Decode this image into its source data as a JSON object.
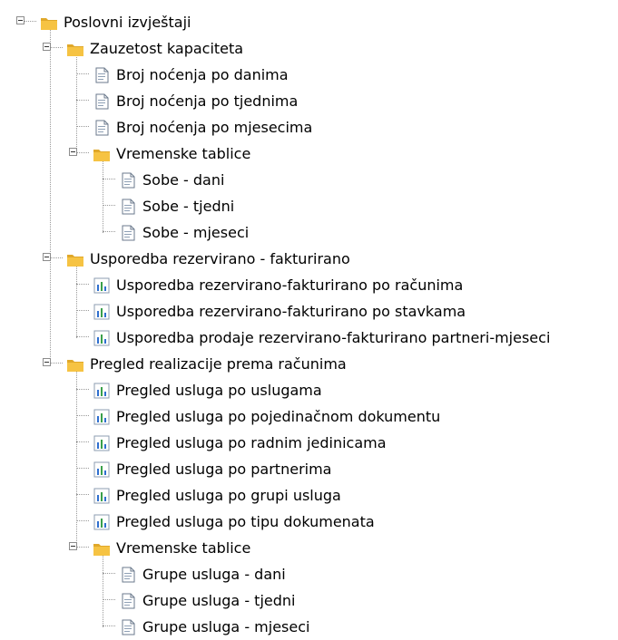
{
  "tree": {
    "nodes": [
      {
        "label": "Poslovni izvještaji",
        "level": 0,
        "kind": "folder",
        "expanded": true
      },
      {
        "label": "Zauzetost kapaciteta",
        "level": 1,
        "kind": "folder",
        "expanded": true
      },
      {
        "label": "Broj noćenja po danima",
        "level": 2,
        "kind": "report"
      },
      {
        "label": "Broj noćenja po tjednima",
        "level": 2,
        "kind": "report"
      },
      {
        "label": "Broj noćenja po mjesecima",
        "level": 2,
        "kind": "report"
      },
      {
        "label": "Vremenske tablice",
        "level": 2,
        "kind": "folder",
        "expanded": true
      },
      {
        "label": "Sobe - dani",
        "level": 3,
        "kind": "report"
      },
      {
        "label": "Sobe - tjedni",
        "level": 3,
        "kind": "report"
      },
      {
        "label": "Sobe - mjeseci",
        "level": 3,
        "kind": "report"
      },
      {
        "label": "Usporedba rezervirano - fakturirano",
        "level": 1,
        "kind": "folder",
        "expanded": true
      },
      {
        "label": "Usporedba rezervirano-fakturirano po računima",
        "level": 2,
        "kind": "chart"
      },
      {
        "label": "Usporedba rezervirano-fakturirano po stavkama",
        "level": 2,
        "kind": "chart"
      },
      {
        "label": "Usporedba prodaje rezervirano-fakturirano partneri-mjeseci",
        "level": 2,
        "kind": "chart"
      },
      {
        "label": "Pregled realizacije prema računima",
        "level": 1,
        "kind": "folder",
        "expanded": true
      },
      {
        "label": "Pregled usluga po uslugama",
        "level": 2,
        "kind": "chart"
      },
      {
        "label": "Pregled usluga po pojedinačnom dokumentu",
        "level": 2,
        "kind": "chart"
      },
      {
        "label": "Pregled usluga po radnim jedinicama",
        "level": 2,
        "kind": "chart"
      },
      {
        "label": "Pregled usluga po partnerima",
        "level": 2,
        "kind": "chart"
      },
      {
        "label": "Pregled usluga po grupi usluga",
        "level": 2,
        "kind": "chart"
      },
      {
        "label": "Pregled usluga po tipu dokumenata",
        "level": 2,
        "kind": "chart"
      },
      {
        "label": "Vremenske tablice",
        "level": 2,
        "kind": "folder",
        "expanded": true
      },
      {
        "label": "Grupe usluga - dani",
        "level": 3,
        "kind": "report"
      },
      {
        "label": "Grupe usluga - tjedni",
        "level": 3,
        "kind": "report"
      },
      {
        "label": "Grupe usluga - mjeseci",
        "level": 3,
        "kind": "report"
      }
    ]
  },
  "colors": {
    "folder": "#f6c343",
    "folder_dark": "#e0a82a",
    "chart_blue": "#2f6fcf",
    "chart_green": "#3aa04a",
    "tree_line": "#9a9a9a"
  },
  "icons": {
    "folder": "folder-icon",
    "report": "document-icon",
    "chart": "bar-chart-icon",
    "toggle": "collapse-icon"
  }
}
